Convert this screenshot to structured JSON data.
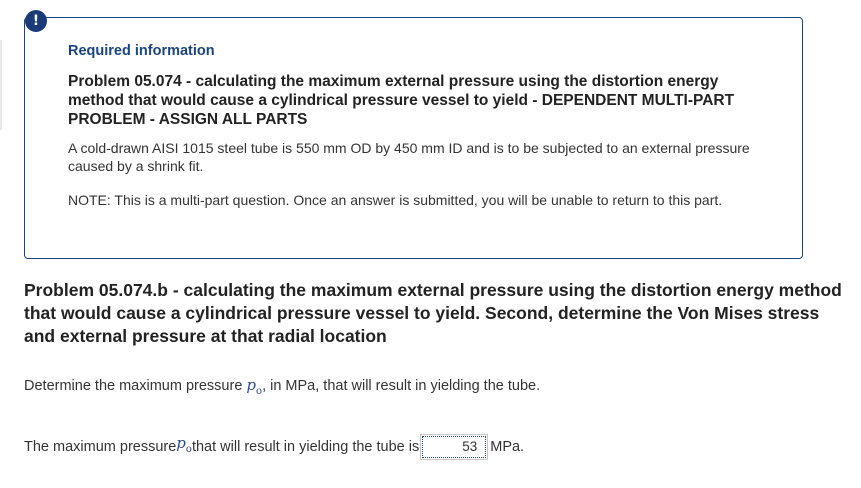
{
  "alert": {
    "icon": "exclamation-icon",
    "glyph": "!"
  },
  "info": {
    "label": "Required information",
    "title": "Problem 05.074 - calculating the maximum external pressure using the distortion energy method that would cause a cylindrical pressure vessel to yield - DEPENDENT MULTI-PART PROBLEM - ASSIGN ALL PARTS",
    "description": "A cold-drawn AISI 1015 steel tube is 550 mm OD by 450 mm ID and is to be subjected to an external pressure caused by a shrink fit.",
    "note": "NOTE: This is a multi-part question. Once an answer is submitted, you will be unable to return to this part."
  },
  "problem": {
    "title": "Problem 05.074.b - calculating the maximum external pressure using the distortion energy method that would cause a cylindrical pressure vessel to yield. Second, determine the Von Mises stress and external pressure at that radial location",
    "question_before": "Determine the maximum pressure ",
    "variable": "p",
    "variable_sub": "o",
    "question_after": ", in MPa, that will result in yielding the tube.",
    "answer_before": "The maximum pressure ",
    "answer_after": " that will result in yielding the tube is",
    "answer_value": "53",
    "unit": "MPa."
  },
  "colors": {
    "accent": "#1a4480",
    "badge": "#1a3a78"
  }
}
